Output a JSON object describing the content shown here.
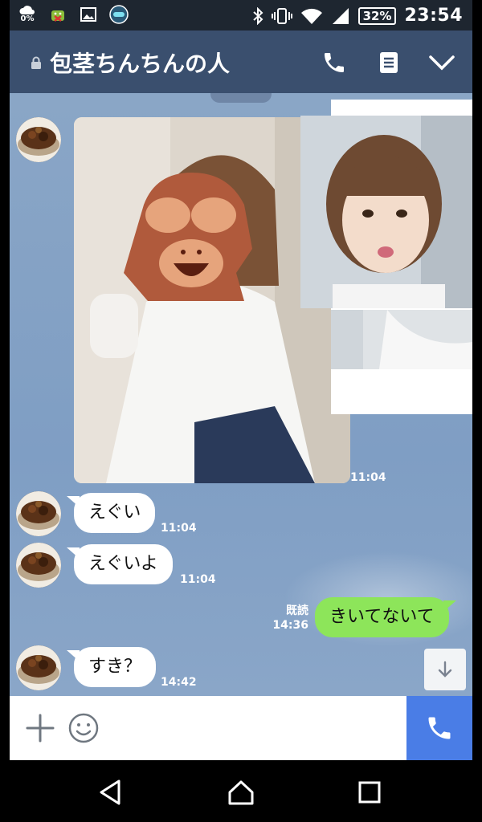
{
  "status": {
    "cloud_pct": "0%",
    "battery": "32%",
    "time": "23:54"
  },
  "header": {
    "title": "包茎ちんちんの人"
  },
  "messages": [
    {
      "text": "えぐい",
      "time": "11:04"
    },
    {
      "text": "えぐいよ",
      "time": "11:04"
    },
    {
      "text": "すき？",
      "time": "14:42"
    }
  ],
  "photo_time": "11:04",
  "sent": {
    "text": "きいてないて",
    "time": "14:36",
    "read": "既読"
  },
  "colors": {
    "header": "#3a4f6e",
    "chat_bg": "#8aa6c6",
    "sent_bubble": "#8de55a",
    "call_button": "#4a7de6"
  },
  "icons": [
    "lock-icon",
    "phone-icon",
    "note-icon",
    "chevron-down-icon",
    "arrow-down-icon",
    "plus-icon",
    "smile-icon",
    "back-icon",
    "home-icon",
    "recents-icon"
  ]
}
